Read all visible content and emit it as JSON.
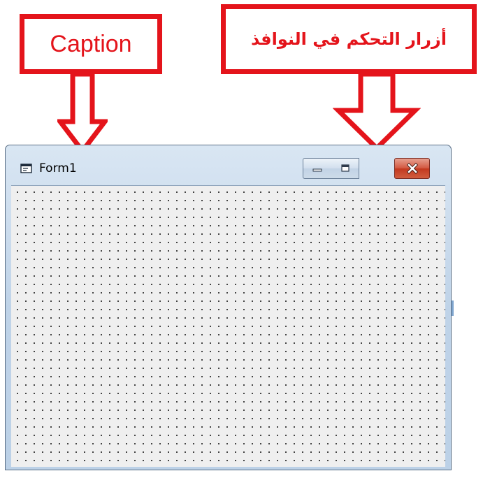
{
  "annotations": {
    "caption_label": "Caption",
    "control_buttons_label": "أزرار التحكم في النوافذ",
    "accent_color": "#e4141b"
  },
  "window": {
    "title": "Form1",
    "icon": "form-window-icon",
    "controls": {
      "minimize_icon": "minimize-icon",
      "maximize_icon": "maximize-icon",
      "close_icon": "close-icon"
    },
    "client_background": "#efefef",
    "grid": "dotted"
  }
}
